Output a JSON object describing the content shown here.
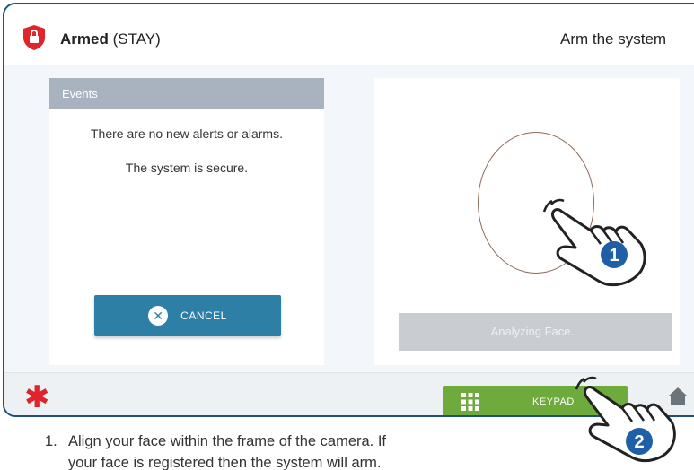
{
  "header": {
    "status_bold": "Armed",
    "status_mode": "(STAY)",
    "title": "Arm the system"
  },
  "events": {
    "header_label": "Events",
    "message_1": "There are no new alerts or alarms.",
    "message_2": "The system is secure."
  },
  "cancel_button": {
    "label": "CANCEL",
    "icon": "x-circle-icon"
  },
  "analyzing_label": "Analyzing Face...",
  "keypad_button": {
    "label": "KEYPAD",
    "icon": "grid-icon"
  },
  "callouts": {
    "one": "1",
    "two": "2"
  },
  "instruction": {
    "number": "1.",
    "line_1": "Align your face within the frame of the camera. If",
    "line_2": "your face is registered then the system will arm."
  },
  "colors": {
    "frame_border": "#1f4f7a",
    "alarm_red": "#e0242c",
    "cancel_blue": "#2e7fa5",
    "keypad_green": "#6eaa3c",
    "callout_blue": "#1f5fa8"
  }
}
